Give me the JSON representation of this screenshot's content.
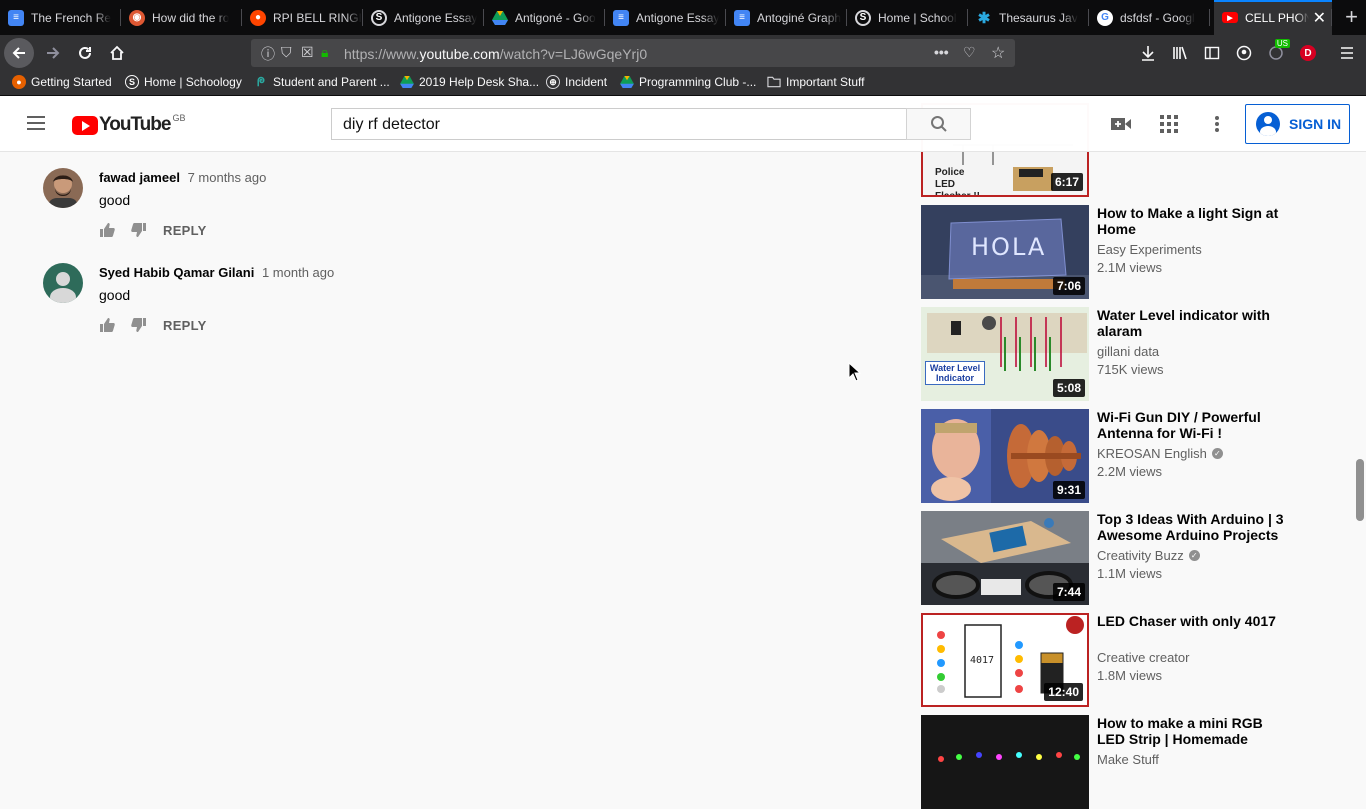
{
  "browser": {
    "tabs": [
      {
        "title": "The French Re",
        "icon": "docs-icon",
        "color": "#4285f4"
      },
      {
        "title": "How did the ro",
        "icon": "duckduckgo-icon",
        "color": "#de5833"
      },
      {
        "title": "RPI BELL RINGI",
        "icon": "reddit-icon",
        "color": "#ff4500"
      },
      {
        "title": "Antigone Essay",
        "icon": "schoology-icon",
        "color": "#5a5a5e"
      },
      {
        "title": "Antigoné - Goo",
        "icon": "drive-icon",
        "color": "#0f9d58"
      },
      {
        "title": "Antigone Essay",
        "icon": "docs-icon",
        "color": "#4285f4"
      },
      {
        "title": "Antoginé Graph",
        "icon": "docs-icon",
        "color": "#4285f4"
      },
      {
        "title": "Home | School",
        "icon": "schoology-icon",
        "color": "#5a5a5e"
      },
      {
        "title": "Thesaurus Jav",
        "icon": "puzzle-icon",
        "color": "#2aa9e0"
      },
      {
        "title": "dsfdsf - Googl",
        "icon": "google-icon",
        "color": "#ffffff"
      },
      {
        "title": "CELL PHONE",
        "icon": "youtube-icon",
        "color": "#ff0000"
      }
    ],
    "new_tab": "+",
    "url_prefix": "https://www.",
    "url_domain": "youtube.com",
    "url_path": "/watch?v=LJ6wGqeYrj0",
    "bookmarks": [
      {
        "label": "Getting Started",
        "icon": "firefox-icon",
        "color": "#e66000"
      },
      {
        "label": "Home | Schoology",
        "icon": "schoology-icon",
        "color": "#5a5a5e"
      },
      {
        "label": "Student and Parent ...",
        "icon": "student-icon",
        "color": "#2aa9a0"
      },
      {
        "label": "2019 Help Desk Sha...",
        "icon": "drive-icon",
        "color": "#f4b400"
      },
      {
        "label": "Incident",
        "icon": "globe-icon",
        "color": "#5a5a5e"
      },
      {
        "label": "Programming Club -...",
        "icon": "drive-icon",
        "color": "#f4b400"
      },
      {
        "label": "Important Stuff",
        "icon": "folder-icon",
        "color": "#d7d7db"
      }
    ],
    "ext_badge": "US",
    "profile_letter": "D"
  },
  "youtube": {
    "wordmark": "YouTube",
    "country": "GB",
    "search_query": "diy rf detector",
    "signin_label": "SIGN IN"
  },
  "comments": [
    {
      "author": "fawad jameel",
      "time": "7 months ago",
      "text": "good",
      "reply": "REPLY"
    },
    {
      "author": "Syed Habib Qamar Gilani",
      "time": "1 month ago",
      "text": "good",
      "reply": "REPLY"
    }
  ],
  "related": [
    {
      "title": "",
      "channel": "",
      "views": "",
      "duration": "6:17",
      "thumb_text": "Police LED Flasher !!",
      "verified": false
    },
    {
      "title": "How to Make a light Sign at Home",
      "channel": "Easy Experiments",
      "views": "2.1M views",
      "duration": "7:06",
      "thumb_text": "HOLA",
      "verified": false
    },
    {
      "title": "Water Level indicator with alaram",
      "channel": "gillani data",
      "views": "715K views",
      "duration": "5:08",
      "thumb_text": "Water Level Indicator",
      "verified": false
    },
    {
      "title": "Wi-Fi Gun DIY / Powerful Antenna for Wi-Fi !",
      "channel": "KREOSAN English",
      "views": "2.2M views",
      "duration": "9:31",
      "thumb_text": "",
      "verified": true
    },
    {
      "title": "Top 3 Ideas With Arduino | 3 Awesome Arduino Projects",
      "channel": "Creativity Buzz",
      "views": "1.1M views",
      "duration": "7:44",
      "thumb_text": "",
      "verified": true
    },
    {
      "title": "LED Chaser with only 4017",
      "channel": "Creative creator",
      "views": "1.8M views",
      "duration": "12:40",
      "thumb_text": "4017",
      "verified": false
    },
    {
      "title": "How to make a mini RGB LED Strip | Homemade",
      "channel": "Make Stuff",
      "views": "",
      "duration": "",
      "thumb_text": "",
      "verified": false
    }
  ]
}
